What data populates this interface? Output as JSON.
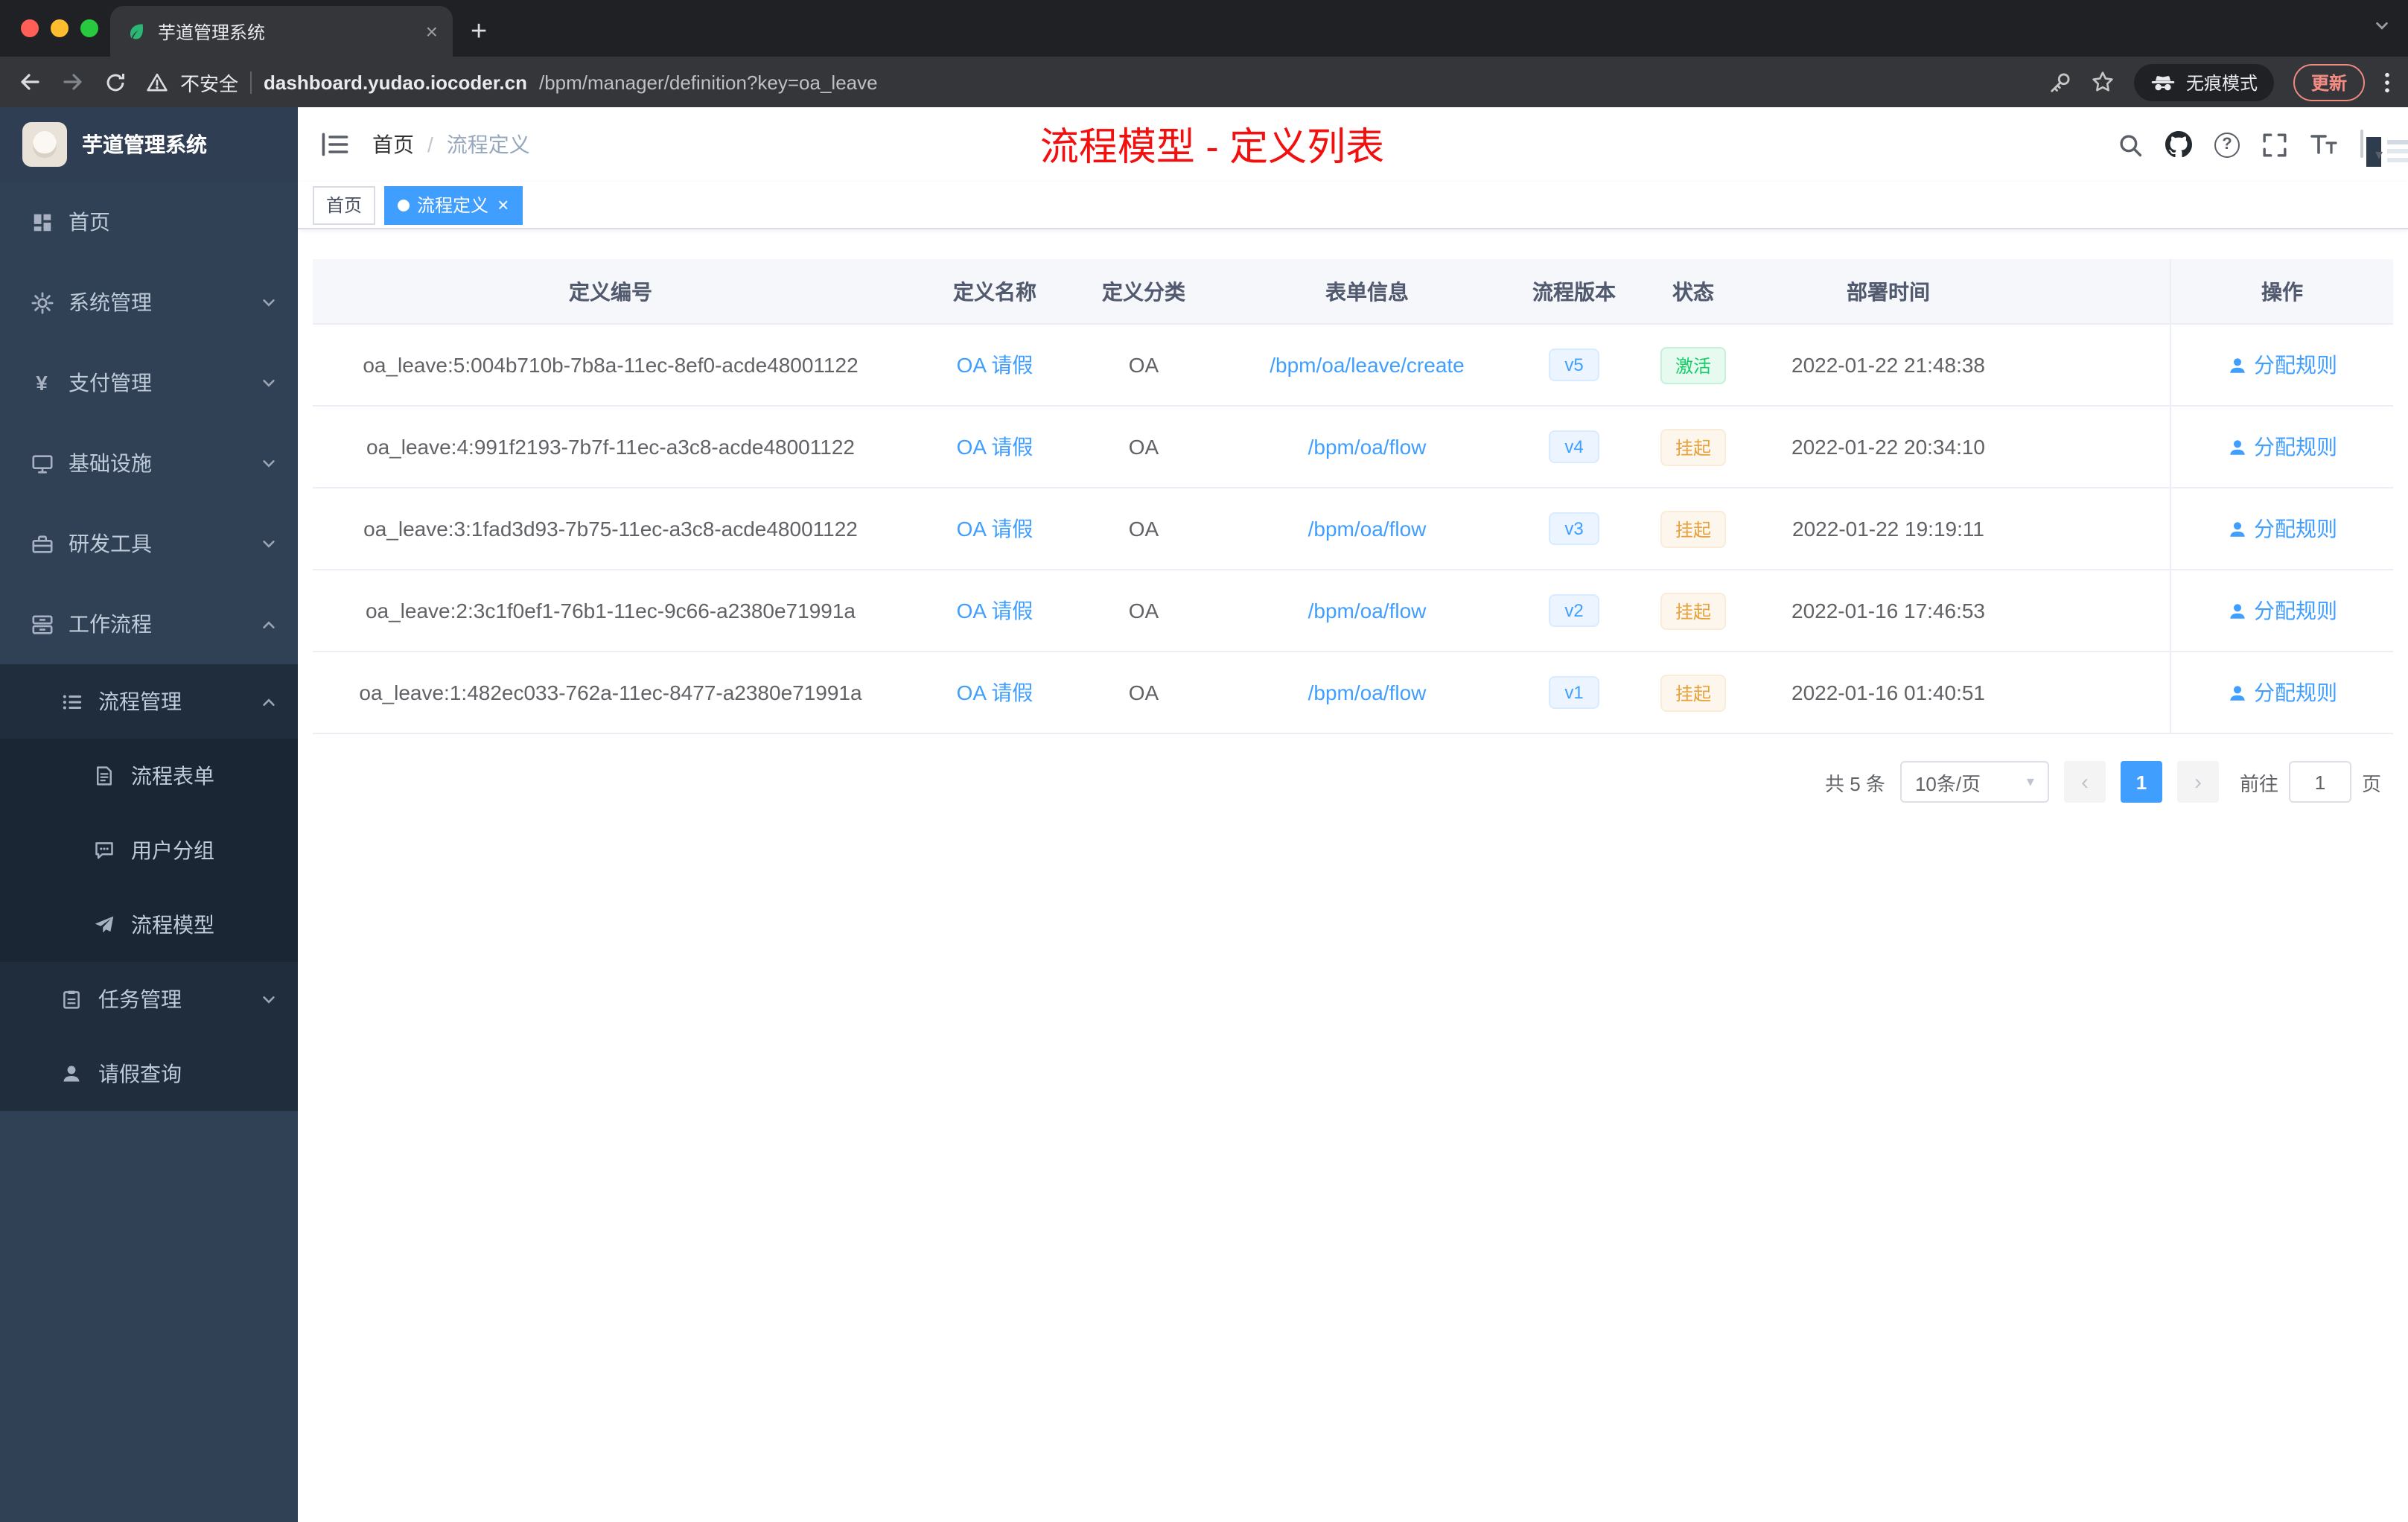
{
  "colors": {
    "primary": "#409eff",
    "title_red": "#f40f0f",
    "success": "#13ce66",
    "warning": "#e6a23c",
    "sidebar_bg": "#304156",
    "submenu_bg": "#1f2d3d"
  },
  "icons": {
    "close_glyph": "×",
    "plus_glyph": "+",
    "caret_glyph": "▾",
    "prev_glyph": "‹",
    "next_glyph": "›",
    "question_glyph": "?",
    "yen_glyph": "¥"
  },
  "browser": {
    "tab_title": "芋道管理系统",
    "security_label": "不安全",
    "url_host": "dashboard.yudao.iocoder.cn",
    "url_path": "/bpm/manager/definition?key=oa_leave",
    "incognito_label": "无痕模式",
    "update_label": "更新"
  },
  "sidebar": {
    "logo_title": "芋道管理系统",
    "items": [
      {
        "label": "首页"
      },
      {
        "label": "系统管理"
      },
      {
        "label": "支付管理"
      },
      {
        "label": "基础设施"
      },
      {
        "label": "研发工具"
      },
      {
        "label": "工作流程"
      }
    ],
    "workflow": {
      "process_mgmt": {
        "label": "流程管理"
      },
      "process_children": [
        {
          "label": "流程表单"
        },
        {
          "label": "用户分组"
        },
        {
          "label": "流程模型"
        }
      ],
      "task_mgmt": {
        "label": "任务管理"
      },
      "leave_query": {
        "label": "请假查询"
      }
    }
  },
  "navbar": {
    "breadcrumb_home": "首页",
    "breadcrumb_separator": "/",
    "breadcrumb_current": "流程定义",
    "overlay_title": "流程模型 - 定义列表"
  },
  "tags": {
    "home": "首页",
    "active": "流程定义"
  },
  "table": {
    "headers": [
      "定义编号",
      "定义名称",
      "定义分类",
      "表单信息",
      "流程版本",
      "状态",
      "部署时间",
      "操作"
    ],
    "rows": [
      {
        "id": "oa_leave:5:004b710b-7b8a-11ec-8ef0-acde48001122",
        "name": "OA 请假",
        "category": "OA",
        "form": "/bpm/oa/leave/create",
        "version": "v5",
        "status": "激活",
        "status_type": "success",
        "deploy_time": "2022-01-22 21:48:38",
        "action": "分配规则"
      },
      {
        "id": "oa_leave:4:991f2193-7b7f-11ec-a3c8-acde48001122",
        "name": "OA 请假",
        "category": "OA",
        "form": "/bpm/oa/flow",
        "version": "v4",
        "status": "挂起",
        "status_type": "warning",
        "deploy_time": "2022-01-22 20:34:10",
        "action": "分配规则"
      },
      {
        "id": "oa_leave:3:1fad3d93-7b75-11ec-a3c8-acde48001122",
        "name": "OA 请假",
        "category": "OA",
        "form": "/bpm/oa/flow",
        "version": "v3",
        "status": "挂起",
        "status_type": "warning",
        "deploy_time": "2022-01-22 19:19:11",
        "action": "分配规则"
      },
      {
        "id": "oa_leave:2:3c1f0ef1-76b1-11ec-9c66-a2380e71991a",
        "name": "OA 请假",
        "category": "OA",
        "form": "/bpm/oa/flow",
        "version": "v2",
        "status": "挂起",
        "status_type": "warning",
        "deploy_time": "2022-01-16 17:46:53",
        "action": "分配规则"
      },
      {
        "id": "oa_leave:1:482ec033-762a-11ec-8477-a2380e71991a",
        "name": "OA 请假",
        "category": "OA",
        "form": "/bpm/oa/flow",
        "version": "v1",
        "status": "挂起",
        "status_type": "warning",
        "deploy_time": "2022-01-16 01:40:51",
        "action": "分配规则"
      }
    ]
  },
  "pagination": {
    "total": "共 5 条",
    "page_size": "10条/页",
    "current_page": "1",
    "goto_label": "前往",
    "goto_value": "1",
    "page_unit": "页"
  }
}
